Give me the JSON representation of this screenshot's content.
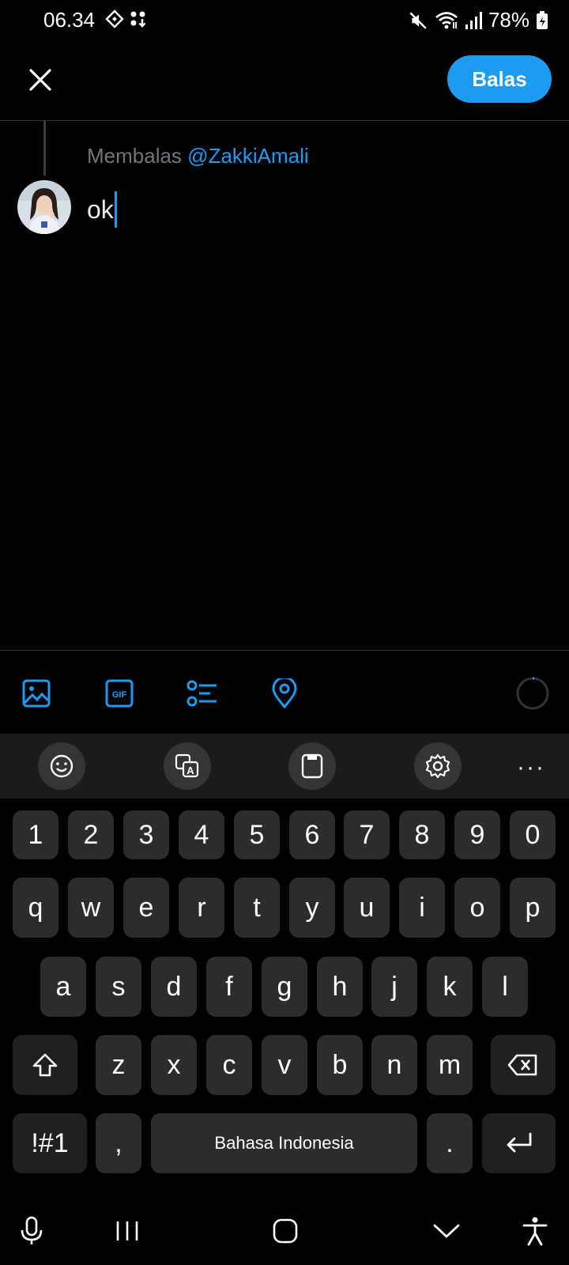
{
  "status_bar": {
    "time": "06.34",
    "battery": "78%",
    "icons": [
      "navigation-diamond-icon",
      "apps-download-icon",
      "mute-icon",
      "wifi-icon",
      "signal-icon",
      "battery-icon"
    ]
  },
  "header": {
    "close_icon": "close-icon",
    "reply_label": "Balas",
    "accent": "#1d9bf0"
  },
  "compose": {
    "replying_prefix": "Membalas",
    "replying_handle": "@ZakkiAmali",
    "text": "ok"
  },
  "toolbar": {
    "icons": [
      "image-icon",
      "gif-icon",
      "poll-icon",
      "location-icon"
    ],
    "counter_icon": "character-counter-icon"
  },
  "keyboard": {
    "top_icons": [
      "emoji-icon",
      "translate-icon",
      "clipboard-icon",
      "settings-icon",
      "more-icon"
    ],
    "more_label": "···",
    "number_row": [
      "1",
      "2",
      "3",
      "4",
      "5",
      "6",
      "7",
      "8",
      "9",
      "0"
    ],
    "row1": [
      "q",
      "w",
      "e",
      "r",
      "t",
      "y",
      "u",
      "i",
      "o",
      "p"
    ],
    "row2": [
      "a",
      "s",
      "d",
      "f",
      "g",
      "h",
      "j",
      "k",
      "l"
    ],
    "row3": [
      "z",
      "x",
      "c",
      "v",
      "b",
      "n",
      "m"
    ],
    "symbols_label": "!#1",
    "comma_label": ",",
    "space_label": "Bahasa Indonesia",
    "period_label": "."
  },
  "navbar": {
    "icons": [
      "microphone-icon",
      "recents-icon",
      "home-icon",
      "hide-keyboard-icon",
      "accessibility-icon"
    ]
  }
}
